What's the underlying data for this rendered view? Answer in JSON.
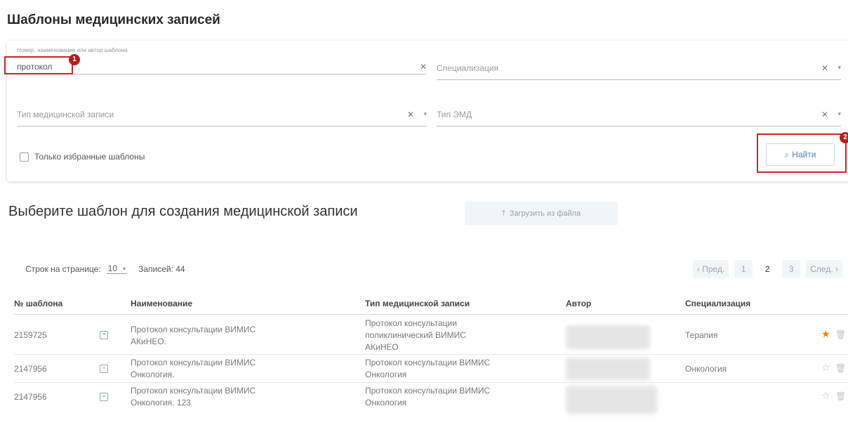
{
  "page_title": "Шаблоны медицинских записей",
  "filters": {
    "search": {
      "label": "Номер, наименование или автор шаблона",
      "value": "протокол",
      "clear_icon": "✕"
    },
    "specialization": {
      "placeholder": "Специализация",
      "clear_icon": "✕",
      "caret": "▾"
    },
    "record_type": {
      "placeholder": "Тип медицинской записи",
      "clear_icon": "✕",
      "caret": "▾"
    },
    "emd_type": {
      "placeholder": "Тип ЭМД",
      "clear_icon": "✕",
      "caret": "▾"
    },
    "favorites_only_label": "Только избранные шаблоны",
    "find_button": "Найти",
    "find_icon": "⌕"
  },
  "markers": {
    "first": "1",
    "second": "2"
  },
  "section_title": "Выберите шаблон для создания медицинской записи",
  "upload_button": {
    "label": "Загрузить из файла",
    "icon": "⤒"
  },
  "pagination": {
    "rows_per_page_label": "Строк на странице:",
    "rows_per_page_value": "10",
    "records_label": "Записей: 44",
    "prev": "‹ Пред.",
    "pages": [
      "1",
      "2",
      "3"
    ],
    "next": "След. ›"
  },
  "table": {
    "headers": [
      "№ шаблона",
      "Наименование",
      "Тип медицинской записи",
      "Автор",
      "Специализация"
    ],
    "rows": [
      {
        "number": "2159725",
        "name": [
          "Протокол консультации ВИМИС",
          "АКиНЕО."
        ],
        "type": [
          "Протокол консультации",
          "поликлинический ВИМИС",
          "АКиНЕО"
        ],
        "specialization": "Терапия",
        "favorite": true
      },
      {
        "number": "2147956",
        "name": [
          "Протокол консультации ВИМИС",
          "Онкология."
        ],
        "type": [
          "Протокол консультации ВИМИС",
          "Онкология"
        ],
        "specialization": "Онкология",
        "favorite": false
      },
      {
        "number": "2147956",
        "name": [
          "Протокол консультации ВИМИС",
          "Онкология. 123"
        ],
        "type": [
          "Протокол консультации ВИМИС",
          "Онкология"
        ],
        "specialization": "",
        "favorite": false
      }
    ],
    "doc_icon": "≡",
    "star_filled": "★",
    "star_empty": "☆",
    "trash_icon": "🗑"
  }
}
